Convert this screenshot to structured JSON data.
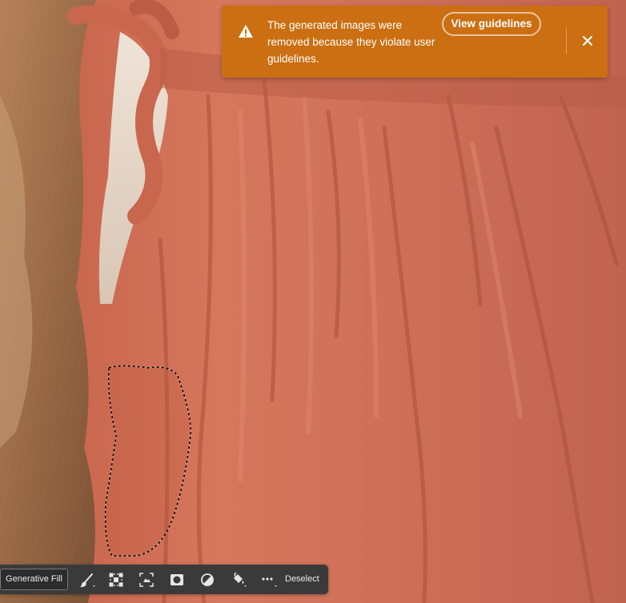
{
  "notification": {
    "icon": "warning-icon",
    "message": "The generated images were removed because they violate user guidelines.",
    "action_label": "View guidelines",
    "close_icon": "close-icon",
    "background_color": "#cb6f12"
  },
  "taskbar": {
    "generative_fill_label": "Generative Fill",
    "tools": [
      {
        "icon": "brush-icon"
      },
      {
        "icon": "transform-selection-icon"
      },
      {
        "icon": "select-subject-icon"
      },
      {
        "icon": "mask-icon"
      },
      {
        "icon": "invert-selection-icon"
      },
      {
        "icon": "fill-bucket-icon"
      },
      {
        "icon": "more-options-icon"
      }
    ],
    "deselect_label": "Deselect"
  }
}
